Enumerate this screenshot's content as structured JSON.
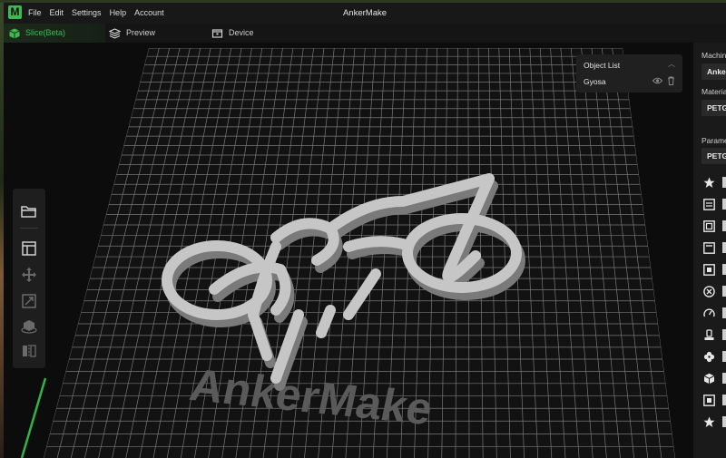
{
  "app": {
    "title": "AnkerMake",
    "logo_letter": "M"
  },
  "menu": [
    {
      "label": "File"
    },
    {
      "label": "Edit"
    },
    {
      "label": "Settings"
    },
    {
      "label": "Help"
    },
    {
      "label": "Account"
    }
  ],
  "tabs": [
    {
      "id": "slice",
      "label": "Slice(Beta)",
      "icon": "cube-icon",
      "active": true
    },
    {
      "id": "preview",
      "label": "Preview",
      "icon": "layers-icon",
      "active": false
    },
    {
      "id": "device",
      "label": "Device",
      "icon": "device-icon",
      "active": false
    }
  ],
  "object_list": {
    "title": "Object List",
    "items": [
      {
        "name": "Gyosa"
      }
    ]
  },
  "viewport": {
    "bed_logo": "AnkerMake",
    "model_color": "#c4c4c4",
    "accent_color": "#3fb950"
  },
  "toolbar": [
    {
      "name": "open-folder-icon",
      "active": true
    },
    {
      "name": "layout-icon",
      "active": true
    },
    {
      "name": "move-icon",
      "active": false
    },
    {
      "name": "scale-icon",
      "active": false
    },
    {
      "name": "rotate-icon",
      "active": false
    },
    {
      "name": "mirror-icon",
      "active": false
    }
  ],
  "right_panel": {
    "machine_label": "Machine",
    "machine_value": "Ankei",
    "material_label": "Material",
    "material_value": "PETG",
    "parameter_label": "Parameters",
    "parameter_value": "PETG",
    "settings_icons": [
      "star-icon",
      "layer-height-icon",
      "wall-icon",
      "top-bottom-icon",
      "infill-icon",
      "support-icon",
      "speed-icon",
      "temperature-icon",
      "cooling-icon",
      "adhesion-icon",
      "special-icon",
      "star-icon"
    ]
  }
}
